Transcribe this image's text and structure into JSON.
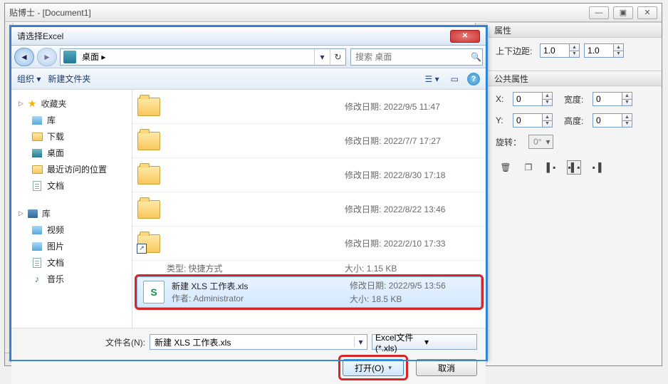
{
  "app": {
    "title": "贴博士 - [Document1]",
    "win_min": "—",
    "win_max": "▣",
    "win_close": "✕"
  },
  "dialog": {
    "title": "请选择Excel",
    "breadcrumb": "桌面 ▸",
    "search_placeholder": "搜索 桌面",
    "toolbar": {
      "organize": "组织 ▾",
      "new_folder": "新建文件夹"
    },
    "sidebar": {
      "fav_title": "收藏夹",
      "fav_items": [
        {
          "icon": "lib",
          "label": "库"
        },
        {
          "icon": "folder",
          "label": "下载"
        },
        {
          "icon": "desktop",
          "label": "桌面"
        },
        {
          "icon": "folder",
          "label": "最近访问的位置"
        },
        {
          "icon": "doc",
          "label": "文档"
        }
      ],
      "lib_title": "库",
      "lib_items": [
        {
          "icon": "lib",
          "label": "视频"
        },
        {
          "icon": "lib",
          "label": "图片"
        },
        {
          "icon": "doc",
          "label": "文档"
        },
        {
          "icon": "music",
          "label": "音乐"
        }
      ]
    },
    "files": [
      {
        "name": "",
        "meta1_label": "修改日期:",
        "meta1_val": "2022/9/5 11:47"
      },
      {
        "name": "",
        "meta1_label": "修改日期:",
        "meta1_val": "2022/7/7 17:27"
      },
      {
        "name": "",
        "meta1_label": "修改日期:",
        "meta1_val": "2022/8/30 17:18"
      },
      {
        "name": "",
        "meta1_label": "修改日期:",
        "meta1_val": "2022/8/22 13:46"
      },
      {
        "name": "",
        "meta1_label": "修改日期:",
        "meta1_val": "2022/2/10 17:33"
      },
      {
        "sub_label": "类型:",
        "sub_val": "快捷方式",
        "size_label": "大小:",
        "size_val": "1.15 KB"
      },
      {
        "name": "新建 XLS 工作表.xls",
        "sub_label": "作者:",
        "sub_val": "Administrator",
        "meta1_label": "修改日期:",
        "meta1_val": "2022/9/5 13:56",
        "size_label": "大小:",
        "size_val": "18.5 KB"
      }
    ],
    "filename_label": "文件名(N):",
    "filename_value": "新建 XLS 工作表.xls",
    "filetype": "Excel文件(*.xls)",
    "open_btn": "打开(O)",
    "cancel_btn": "取消"
  },
  "panel": {
    "section1": "属性",
    "margins_label": "上下边距:",
    "margin_top": "1.0",
    "margin_bottom": "1.0",
    "section2": "公共属性",
    "x_label": "X:",
    "x_val": "0",
    "w_label": "宽度:",
    "w_val": "0",
    "y_label": "Y:",
    "y_val": "0",
    "h_label": "高度:",
    "h_val": "0",
    "rot_label": "旋转：",
    "rot_val": "0°"
  }
}
